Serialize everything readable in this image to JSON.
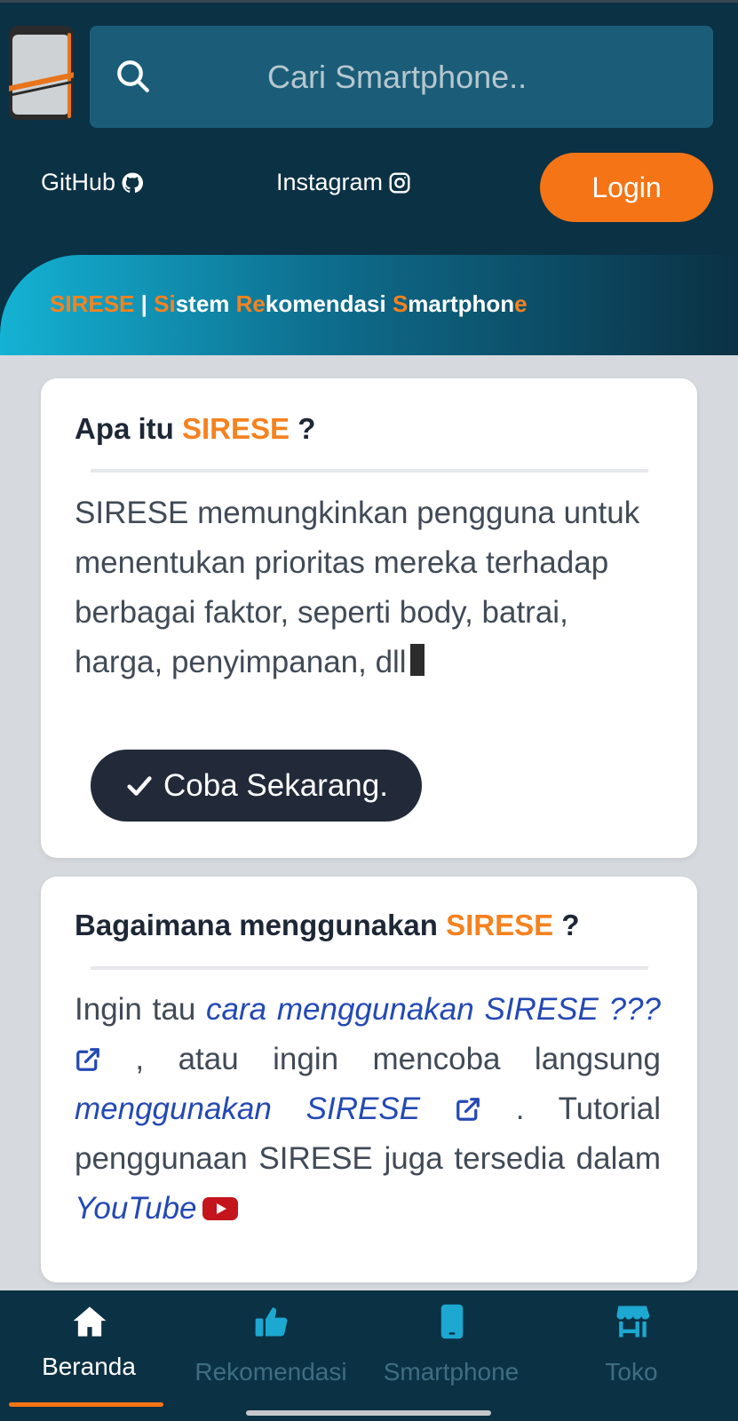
{
  "header": {
    "search_placeholder": "Cari Smartphone..",
    "github_label": "GitHub",
    "instagram_label": "Instagram",
    "login_label": "Login"
  },
  "banner": {
    "part1": "SI",
    "part2": "RESE",
    "sep": " | ",
    "s1o": "Si",
    "s1": "stem ",
    "s2o": "Re",
    "s2": "komendasi ",
    "s3o": "S",
    "s3": "martphon",
    "s4o": "e"
  },
  "card1": {
    "title_prefix": "Apa itu ",
    "title_brand": "SIRESE",
    "title_suffix": " ?",
    "body": "SIRESE memungkinkan pengguna untuk menentukan prioritas mereka terhadap berbagai faktor, seperti body, batrai, harga, penyimpanan, dll",
    "cta_label": "Coba Sekarang."
  },
  "card2": {
    "title_prefix": "Bagaimana menggunakan ",
    "title_brand": "SIRESE",
    "title_suffix": " ?",
    "t1": "Ingin tau ",
    "link1": "cara menggunakan SIRESE ???",
    "t2": " , atau ingin mencoba langsung ",
    "link2": "menggunakan SIRESE",
    "t3": " . Tutorial penggunaan SIRESE juga tersedia dalam ",
    "link3": "YouTube"
  },
  "bottom_nav": [
    {
      "label": "Beranda",
      "icon": "home-icon",
      "active": true
    },
    {
      "label": "Rekomendasi",
      "icon": "thumbs-up-icon",
      "active": false
    },
    {
      "label": "Smartphone",
      "icon": "smartphone-icon",
      "active": false
    },
    {
      "label": "Toko",
      "icon": "store-icon",
      "active": false
    }
  ],
  "colors": {
    "header_bg": "#0b3144",
    "accent": "#f57416",
    "search_bg": "#1b5d78",
    "link": "#2449b5",
    "dark_button": "#222a39"
  }
}
